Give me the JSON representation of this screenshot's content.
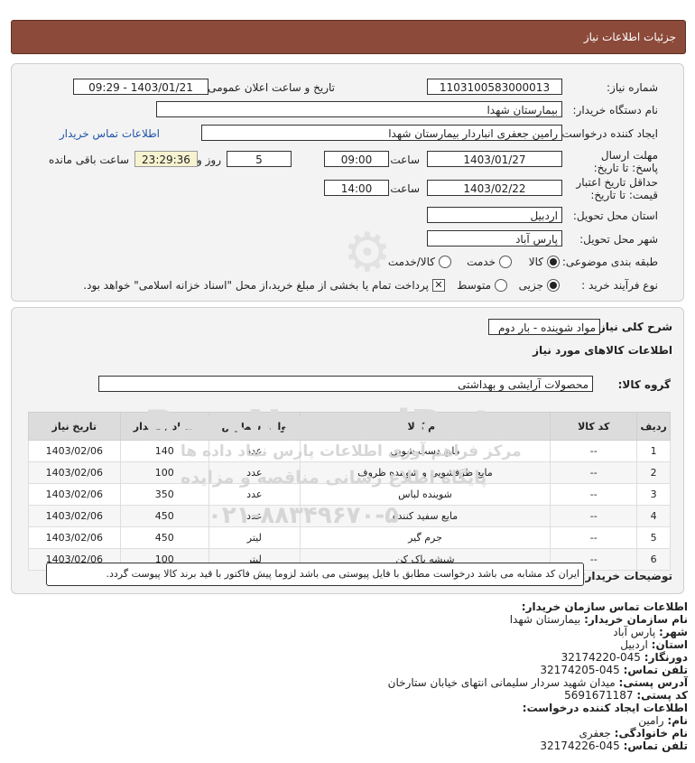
{
  "header": {
    "title": "جزئیات اطلاعات نیاز"
  },
  "form": {
    "need_number_label": "شماره نیاز:",
    "need_number": "1103100583000013",
    "announce_label": "تاریخ و ساعت اعلان عمومی:",
    "announce_value": "1403/01/21 - 09:29",
    "buyer_label": "نام دستگاه خریدار:",
    "buyer_value": "بیمارستان شهدا",
    "creator_label": "ایجاد کننده درخواست:",
    "creator_value": "رامین جعفری انباردار بیمارستان شهدا",
    "buyer_contact_link": "اطلاعات تماس خریدار",
    "deadline_label": "مهلت ارسال پاسخ: تا تاریخ:",
    "deadline_date": "1403/01/27",
    "time_label": "ساعت",
    "deadline_time": "09:00",
    "days_value": "5",
    "days_label": "روز و",
    "remaining_time": "23:29:36",
    "remaining_label": "ساعت باقی مانده",
    "validity_label": "حداقل تاریخ اعتبار قیمت: تا تاریخ:",
    "validity_date": "1403/02/22",
    "validity_time": "14:00",
    "province_label": "استان محل تحویل:",
    "province_value": "اردبیل",
    "city_label": "شهر محل تحویل:",
    "city_value": "پارس آباد",
    "category_label": "طبقه بندی موضوعی:",
    "category_options": [
      "کالا",
      "خدمت",
      "کالا/خدمت"
    ],
    "process_label": "نوع فرآیند خرید :",
    "process_options": [
      "جزیی",
      "متوسط"
    ],
    "payment_note": "پرداخت تمام یا بخشی از مبلغ خرید،از محل \"اسناد خزانه اسلامی\" خواهد بود."
  },
  "details": {
    "need_desc_label": "شرح کلی نیاز:",
    "need_desc_value": "مواد شوینده - بار دوم",
    "goods_info_title": "اطلاعات کالاهای مورد نیاز",
    "group_label": "گروه کالا:",
    "group_value": "محصولات آرایشی و بهداشتی",
    "columns": [
      "ردیف",
      "کد کالا",
      "نام کالا",
      "واحد شمارش",
      "تعداد / مقدار",
      "تاریخ نیاز"
    ],
    "rows": [
      [
        "1",
        "--",
        "مایع دست شویی",
        "عدد",
        "140",
        "1403/02/06"
      ],
      [
        "2",
        "--",
        "مایع ظرفشویی و شوینده ظروف",
        "عدد",
        "100",
        "1403/02/06"
      ],
      [
        "3",
        "--",
        "شوینده لباس",
        "عدد",
        "350",
        "1403/02/06"
      ],
      [
        "4",
        "--",
        "مایع سفید کننده",
        "عدد",
        "450",
        "1403/02/06"
      ],
      [
        "5",
        "--",
        "جرم گیر",
        "لیتر",
        "450",
        "1403/02/06"
      ],
      [
        "6",
        "--",
        "شیشه پاک کن",
        "لیتر",
        "100",
        "1403/02/06"
      ]
    ],
    "buyer_notes_label": "توضیحات خریدار:",
    "buyer_notes_value": "ایران کد مشابه می باشد درخواست مطابق با فایل پیوستی می باشد لزوما پیش فاکتور با قید برند کالا پیوست گردد."
  },
  "contact": {
    "title": "اطلاعات تماس سازمان خریدار:",
    "org_label": "نام سازمان خریدار:",
    "org_value": "بیمارستان شهدا",
    "city_label": "شهر:",
    "city_value": "پارس آباد",
    "province_label": "استان:",
    "province_value": "اردبیل",
    "fax_label": "دورنگار:",
    "fax_value": "045-32174220",
    "phone_label": "تلفن تماس:",
    "phone_value": "045-32174205",
    "address_label": "آدرس پستی:",
    "address_value": "میدان شهید سردار سلیمانی انتهای خیابان ستارخان",
    "postal_label": "کد پستی:",
    "postal_value": "5691671187",
    "creator_title": "اطلاعات ایجاد کننده درخواست:",
    "name_label": "نام:",
    "name_value": "رامین",
    "family_label": "نام خانوادگی:",
    "family_value": "جعفری",
    "creator_phone_label": "تلفن تماس:",
    "creator_phone_value": "045-32174226"
  },
  "watermark": {
    "brand": "ParsNamadData",
    "line1": "مرکز فراهم آوری اطلاعات پارس نماد داده ها",
    "line2": "پایگاه اطلاع رسانی مناقصه و مزایده",
    "phone": "۰۲۱-۸۸۳۴۹۶۷۰-۵"
  }
}
